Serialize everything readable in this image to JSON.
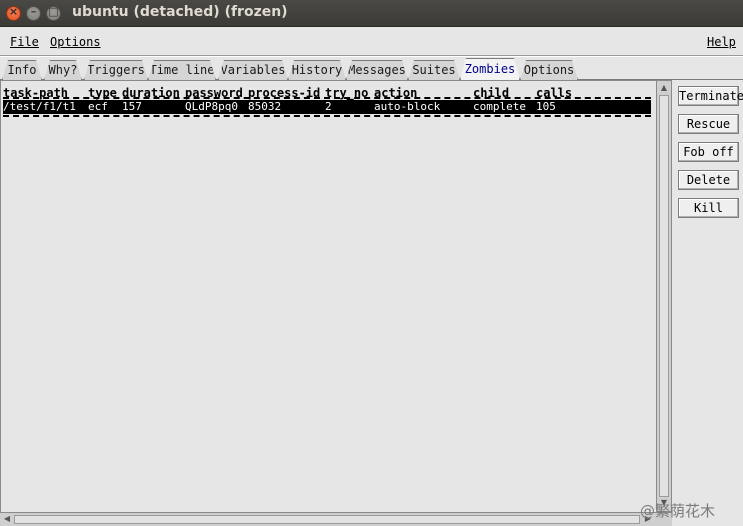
{
  "window": {
    "title": "ubuntu (detached) (frozen)",
    "close_glyph": "×",
    "minimize_glyph": "–",
    "maximize_glyph": "□"
  },
  "menubar": {
    "file_label": "File",
    "options_label": "Options",
    "help_label": "Help"
  },
  "tabs": [
    "Info",
    "Why?",
    "Triggers",
    "Time line",
    "Variables",
    "History",
    "Messages",
    "Suites",
    "Zombies",
    "Options"
  ],
  "active_tab": "Zombies",
  "table": {
    "columns": [
      "task-path",
      "type",
      "duration",
      "password",
      "process-id",
      "try_no",
      "action",
      "child",
      "calls"
    ],
    "rows": [
      [
        "/test/f1/t1",
        "ecf",
        "157",
        "QLdP8pq0",
        "85032",
        "2",
        "auto-block",
        "complete",
        "105"
      ]
    ]
  },
  "side_buttons": [
    "Terminate",
    "Rescue",
    "Fob off",
    "Delete",
    "Kill"
  ],
  "watermark": "@繁荫花木",
  "scroll": {
    "up_arrow": "▲",
    "down_arrow": "▼",
    "left_arrow": "◀",
    "right_arrow": "▶"
  }
}
